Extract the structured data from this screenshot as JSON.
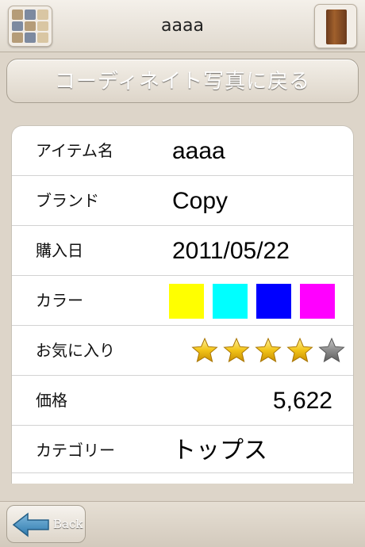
{
  "navbar": {
    "title": "aaaa"
  },
  "back_to_photo": {
    "label": "コーディネイト写真に戻る"
  },
  "details": {
    "item_name": {
      "label": "アイテム名",
      "value": "aaaa"
    },
    "brand": {
      "label": "ブランド",
      "value": "Copy"
    },
    "purchase_date": {
      "label": "購入日",
      "value": "2011/05/22"
    },
    "color": {
      "label": "カラー",
      "swatches": [
        "#ffff00",
        "#00ffff",
        "#0000ff",
        "#ff00ff"
      ]
    },
    "favorite": {
      "label": "お気に入り",
      "rating": 4,
      "max": 5
    },
    "price": {
      "label": "価格",
      "value": "5,622"
    },
    "category": {
      "label": "カテゴリー",
      "value": "トップス"
    }
  },
  "toolbar": {
    "back_label": "Back"
  }
}
